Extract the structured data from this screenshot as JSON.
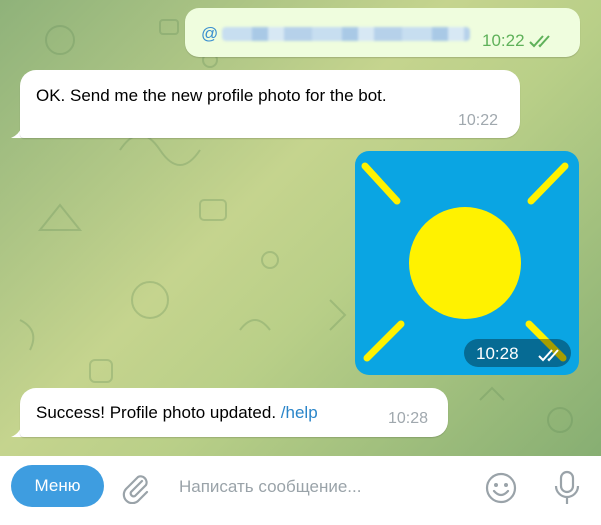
{
  "chat": {
    "outgoing_text": {
      "handle_prefix": "@",
      "time": "10:22",
      "status_icon": "double-check-icon"
    },
    "incoming_1": {
      "text": "OK. Send me the new profile photo for the bot.",
      "time": "10:22"
    },
    "outgoing_photo": {
      "time": "10:28",
      "status_icon": "double-check-icon",
      "image": "sun-icon"
    },
    "incoming_2": {
      "text": "Success! Profile photo updated.",
      "command": "/help",
      "time": "10:28"
    }
  },
  "composer": {
    "menu_label": "Меню",
    "placeholder": "Написать сообщение...",
    "icons": [
      "paperclip-icon",
      "smiley-icon",
      "microphone-icon"
    ]
  },
  "colors": {
    "outgoing_bubble": "#effdde",
    "incoming_bubble": "#ffffff",
    "link": "#2a85c9",
    "menu_button": "#3e9de0",
    "photo_bg": "#0aa5e3",
    "sun": "#fff200"
  }
}
